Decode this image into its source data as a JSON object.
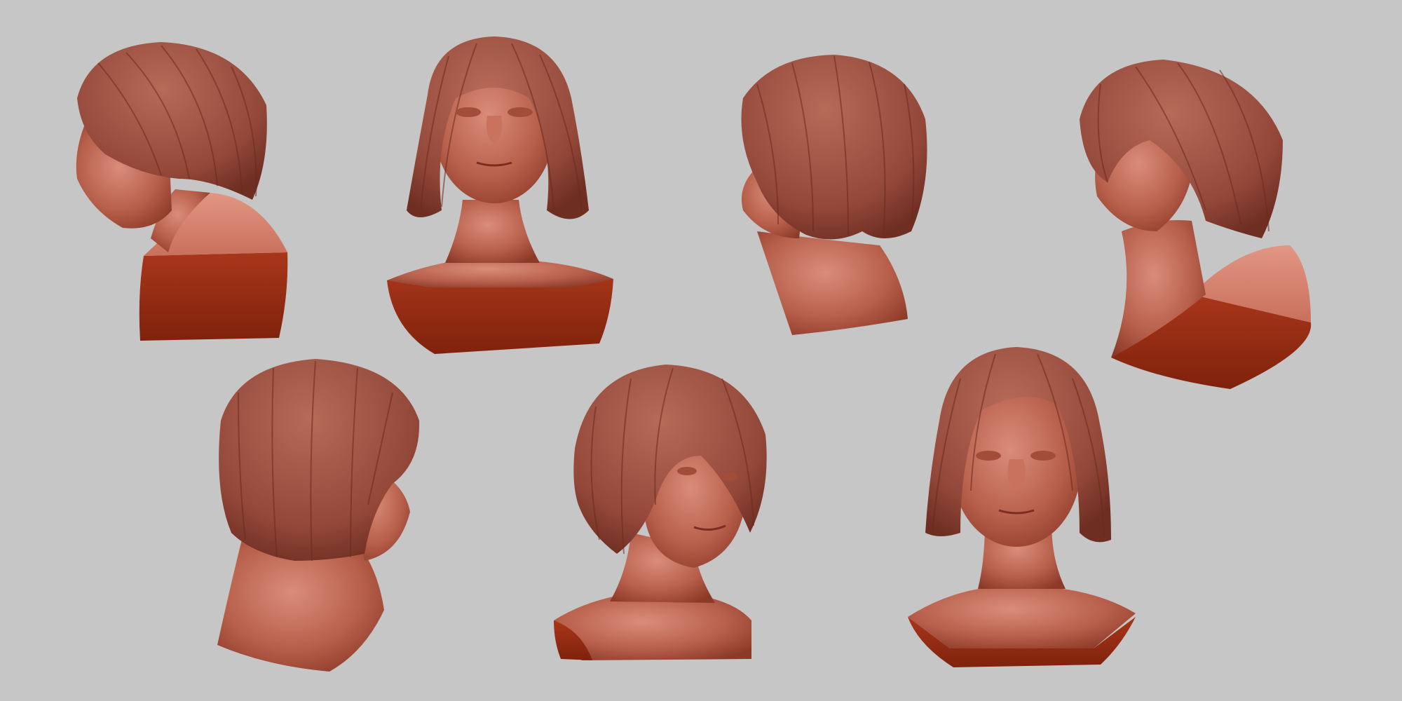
{
  "scene": {
    "background_color": "#c6c6c6",
    "clay_color": "#b0604f",
    "clay_shadow_color": "#8a2a14",
    "clay_cut_color": "#9e2e12",
    "clay_light_color": "#dc8e7c",
    "busts": [
      {
        "view": "left-profile-low-angle"
      },
      {
        "view": "front-low-angle"
      },
      {
        "view": "back-left-three-quarter"
      },
      {
        "view": "left-three-quarter-low-angle"
      },
      {
        "view": "back-right-three-quarter"
      },
      {
        "view": "right-three-quarter"
      },
      {
        "view": "front"
      }
    ]
  }
}
